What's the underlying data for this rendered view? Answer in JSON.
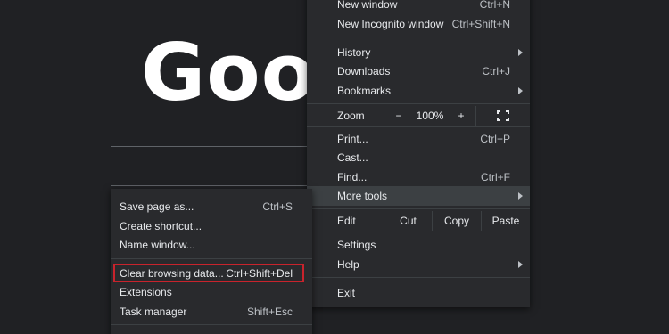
{
  "background": {
    "logo_text": "Goog"
  },
  "main_menu": {
    "new_window": {
      "label": "New window",
      "shortcut": "Ctrl+N"
    },
    "new_incognito": {
      "label": "New Incognito window",
      "shortcut": "Ctrl+Shift+N"
    },
    "history": {
      "label": "History"
    },
    "downloads": {
      "label": "Downloads",
      "shortcut": "Ctrl+J"
    },
    "bookmarks": {
      "label": "Bookmarks"
    },
    "zoom": {
      "label": "Zoom",
      "minus": "−",
      "value": "100%",
      "plus": "+"
    },
    "print": {
      "label": "Print...",
      "shortcut": "Ctrl+P"
    },
    "cast": {
      "label": "Cast..."
    },
    "find": {
      "label": "Find...",
      "shortcut": "Ctrl+F"
    },
    "more_tools": {
      "label": "More tools"
    },
    "edit": {
      "label": "Edit",
      "cut": "Cut",
      "copy": "Copy",
      "paste": "Paste"
    },
    "settings": {
      "label": "Settings"
    },
    "help": {
      "label": "Help"
    },
    "exit": {
      "label": "Exit"
    }
  },
  "sub_menu": {
    "save_page": {
      "label": "Save page as...",
      "shortcut": "Ctrl+S"
    },
    "create_shortcut": {
      "label": "Create shortcut..."
    },
    "name_window": {
      "label": "Name window..."
    },
    "clear_browsing": {
      "label": "Clear browsing data...",
      "shortcut": "Ctrl+Shift+Del"
    },
    "extensions": {
      "label": "Extensions"
    },
    "task_manager": {
      "label": "Task manager",
      "shortcut": "Shift+Esc"
    }
  },
  "colors": {
    "highlight_box": "#c8232c",
    "menu_bg": "#292a2d",
    "page_bg": "#202124"
  }
}
